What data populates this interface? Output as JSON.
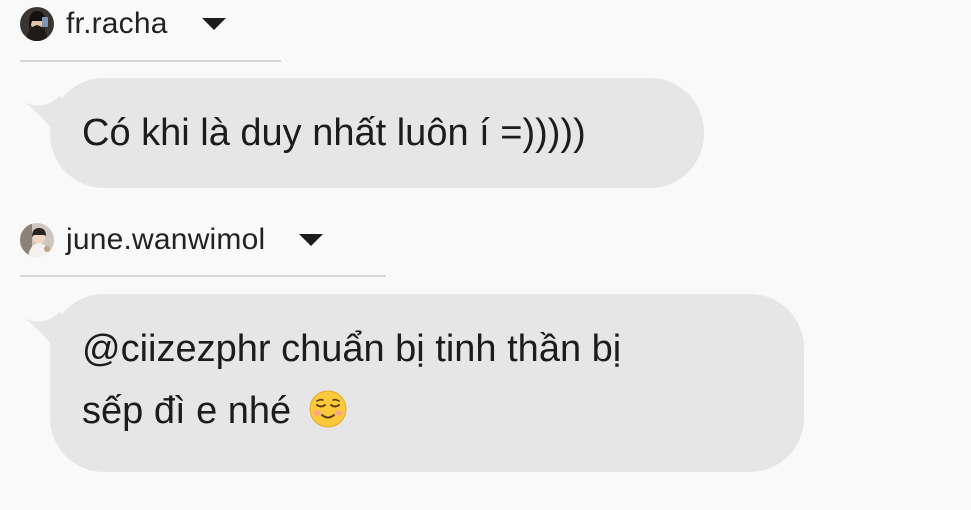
{
  "messages": [
    {
      "username": "fr.racha",
      "text": "Có khi là duy nhất luôn í =)))))"
    },
    {
      "username": "june.wanwimol",
      "text_line1": "@ciizezphr chuẩn bị tinh thần bị",
      "text_line2": "sếp đì e nhé",
      "emoji": "smiling-face-icon"
    }
  ],
  "colors": {
    "background": "#f9f9f9",
    "bubble": "#e6e6e6",
    "divider": "#d6d6d6",
    "text": "#1c1c1c"
  }
}
